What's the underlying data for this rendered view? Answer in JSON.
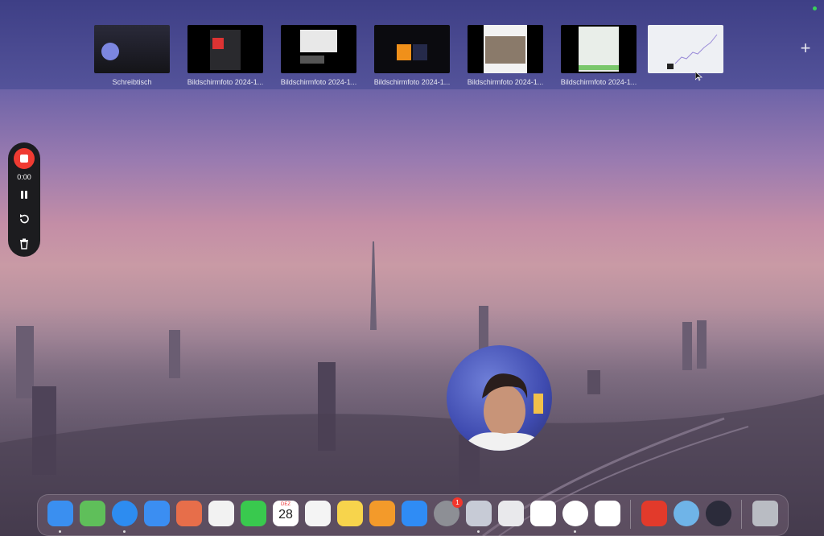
{
  "spaces": [
    {
      "label": "Schreibtisch"
    },
    {
      "label": "Bildschirmfoto 2024-1..."
    },
    {
      "label": "Bildschirmfoto 2024-1..."
    },
    {
      "label": "Bildschirmfoto 2024-1..."
    },
    {
      "label": "Bildschirmfoto 2024-1..."
    },
    {
      "label": "Bildschirmfoto 2024-1..."
    },
    {
      "label": ""
    }
  ],
  "add_space_label": "+",
  "recorder": {
    "time": "0:00"
  },
  "dock": {
    "calendar_month": "DEZ",
    "calendar_day": "28",
    "settings_badge": "1",
    "items": [
      {
        "name": "finder-icon",
        "color": "#3a8ff0"
      },
      {
        "name": "maps-icon",
        "color": "#5fbf5a"
      },
      {
        "name": "safari-icon",
        "color": "#2d8cf0"
      },
      {
        "name": "mail-icon",
        "color": "#3b8ef2"
      },
      {
        "name": "launchpad-icon",
        "color": "#e76e4a"
      },
      {
        "name": "photos-icon",
        "color": "#f2f2f2"
      },
      {
        "name": "facetime-icon",
        "color": "#39c94e"
      },
      {
        "name": "calendar-icon",
        "color": "#ffffff"
      },
      {
        "name": "reminders-icon",
        "color": "#f4f4f4"
      },
      {
        "name": "notes-icon",
        "color": "#f7d44c"
      },
      {
        "name": "pages-icon",
        "color": "#f39a2a"
      },
      {
        "name": "app-store-icon",
        "color": "#2f8cf5"
      },
      {
        "name": "system-settings-icon",
        "color": "#8d8f95"
      },
      {
        "name": "preview-icon",
        "color": "#c7cbd6"
      },
      {
        "name": "script-editor-icon",
        "color": "#e9e9ec"
      },
      {
        "name": "unity-icon",
        "color": "#ffffff"
      },
      {
        "name": "chrome-icon",
        "color": "#ffffff"
      },
      {
        "name": "nordvpn-icon",
        "color": "#ffffff"
      },
      {
        "name": "sublime-s-icon",
        "color": "#e23a2b"
      },
      {
        "name": "quicktime-icon",
        "color": "#6fb4e8"
      },
      {
        "name": "obs-icon",
        "color": "#2b2b3a"
      },
      {
        "name": "trash-icon",
        "color": "#b9bcc3"
      }
    ]
  }
}
